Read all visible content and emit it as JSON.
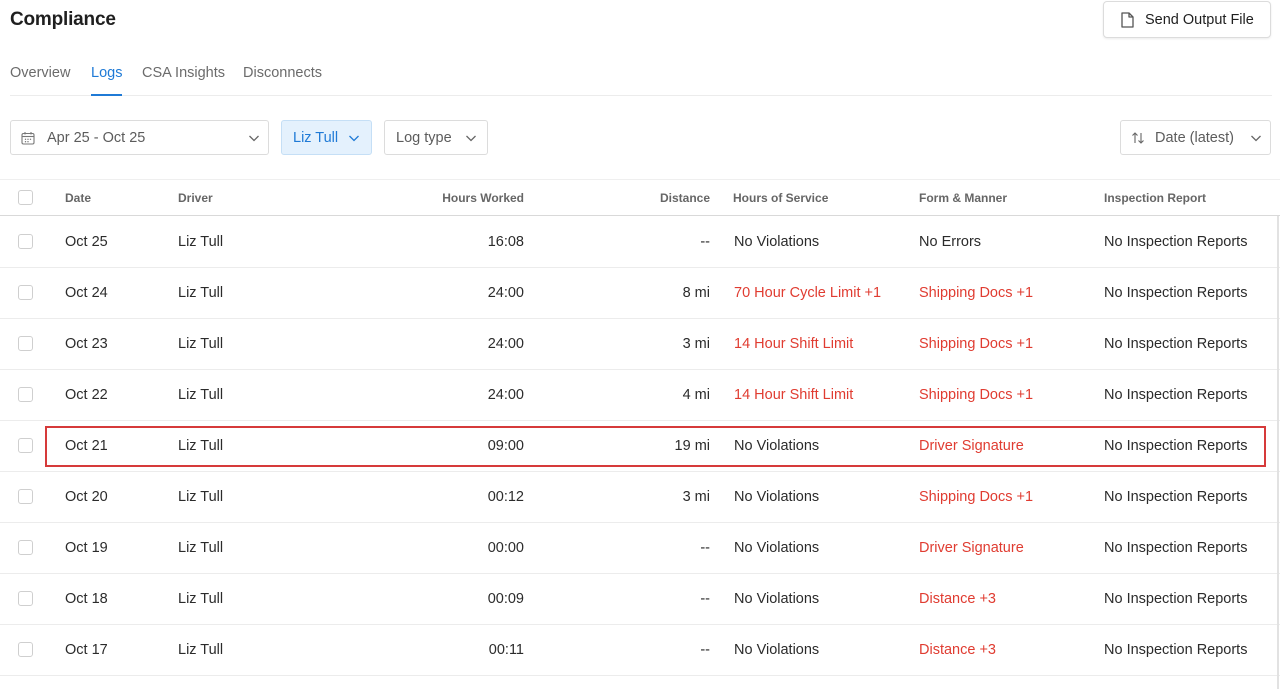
{
  "header": {
    "title": "Compliance",
    "send_button_label": "Send Output File"
  },
  "tabs": [
    {
      "label": "Overview",
      "active": false
    },
    {
      "label": "Logs",
      "active": true
    },
    {
      "label": "CSA Insights",
      "active": false
    },
    {
      "label": "Disconnects",
      "active": false
    }
  ],
  "filters": {
    "date_range": "Apr 25 - Oct 25",
    "driver": "Liz Tull",
    "log_type": "Log type",
    "sort": "Date (latest)"
  },
  "table": {
    "columns": [
      "Date",
      "Driver",
      "Hours Worked",
      "Distance",
      "Hours of Service",
      "Form & Manner",
      "Inspection Report"
    ],
    "rows": [
      {
        "date": "Oct 25",
        "driver": "Liz Tull",
        "hours": "16:08",
        "distance": "--",
        "hos": "No Violations",
        "hos_alert": false,
        "form": "No Errors",
        "form_alert": false,
        "inspection": "No Inspection Reports"
      },
      {
        "date": "Oct 24",
        "driver": "Liz Tull",
        "hours": "24:00",
        "distance": "8 mi",
        "hos": "70 Hour Cycle Limit +1",
        "hos_alert": true,
        "form": "Shipping Docs +1",
        "form_alert": true,
        "inspection": "No Inspection Reports"
      },
      {
        "date": "Oct 23",
        "driver": "Liz Tull",
        "hours": "24:00",
        "distance": "3 mi",
        "hos": "14 Hour Shift Limit",
        "hos_alert": true,
        "form": "Shipping Docs +1",
        "form_alert": true,
        "inspection": "No Inspection Reports"
      },
      {
        "date": "Oct 22",
        "driver": "Liz Tull",
        "hours": "24:00",
        "distance": "4 mi",
        "hos": "14 Hour Shift Limit",
        "hos_alert": true,
        "form": "Shipping Docs +1",
        "form_alert": true,
        "inspection": "No Inspection Reports"
      },
      {
        "date": "Oct 21",
        "driver": "Liz Tull",
        "hours": "09:00",
        "distance": "19 mi",
        "hos": "No Violations",
        "hos_alert": false,
        "form": "Driver Signature",
        "form_alert": true,
        "inspection": "No Inspection Reports"
      },
      {
        "date": "Oct 20",
        "driver": "Liz Tull",
        "hours": "00:12",
        "distance": "3 mi",
        "hos": "No Violations",
        "hos_alert": false,
        "form": "Shipping Docs +1",
        "form_alert": true,
        "inspection": "No Inspection Reports"
      },
      {
        "date": "Oct 19",
        "driver": "Liz Tull",
        "hours": "00:00",
        "distance": "--",
        "hos": "No Violations",
        "hos_alert": false,
        "form": "Driver Signature",
        "form_alert": true,
        "inspection": "No Inspection Reports"
      },
      {
        "date": "Oct 18",
        "driver": "Liz Tull",
        "hours": "00:09",
        "distance": "--",
        "hos": "No Violations",
        "hos_alert": false,
        "form": "Distance +3",
        "form_alert": true,
        "inspection": "No Inspection Reports"
      },
      {
        "date": "Oct 17",
        "driver": "Liz Tull",
        "hours": "00:11",
        "distance": "--",
        "hos": "No Violations",
        "hos_alert": false,
        "form": "Distance +3",
        "form_alert": true,
        "inspection": "No Inspection Reports"
      }
    ]
  },
  "colors": {
    "accent": "#1f7ad6",
    "alert": "#e03c31",
    "highlight_border": "#d63a3a"
  }
}
